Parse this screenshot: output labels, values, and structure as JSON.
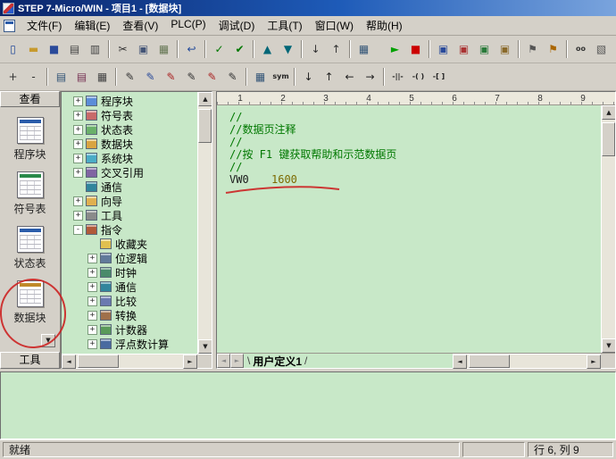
{
  "colors": {
    "editor-bg": "#c8e8c8",
    "comment-color": "#007800",
    "value-color": "#7c6a00",
    "annotation-color": "#cc2222",
    "title-gradient-start": "#0a246a",
    "title-gradient-end": "#7aa4dd"
  },
  "window": {
    "title": "STEP 7-Micro/WIN - 项目1 - [数据块]"
  },
  "menu": {
    "items": [
      {
        "name": "menu-file",
        "label": "文件(F)"
      },
      {
        "name": "menu-edit",
        "label": "编辑(E)"
      },
      {
        "name": "menu-view",
        "label": "查看(V)"
      },
      {
        "name": "menu-plc",
        "label": "PLC(P)"
      },
      {
        "name": "menu-debug",
        "label": "调试(D)"
      },
      {
        "name": "menu-tools",
        "label": "工具(T)"
      },
      {
        "name": "menu-window",
        "label": "窗口(W)"
      },
      {
        "name": "menu-help",
        "label": "帮助(H)"
      }
    ]
  },
  "toolbar_main": {
    "items": [
      {
        "name": "new-button",
        "glyph": "▯",
        "color": "#234a9a"
      },
      {
        "name": "open-button",
        "glyph": "▬",
        "color": "#c79a2e"
      },
      {
        "name": "save-button",
        "glyph": "■",
        "color": "#2a4a9a"
      },
      {
        "name": "print-button",
        "glyph": "▤",
        "color": "#444444"
      },
      {
        "name": "print-preview-button",
        "glyph": "▥",
        "color": "#444444"
      },
      {
        "kind": "sep"
      },
      {
        "name": "cut-button",
        "glyph": "✂",
        "color": "#333333"
      },
      {
        "name": "copy-button",
        "glyph": "▣",
        "color": "#445577"
      },
      {
        "name": "paste-button",
        "glyph": "▦",
        "color": "#667755"
      },
      {
        "kind": "sep"
      },
      {
        "name": "undo-button",
        "glyph": "↩",
        "color": "#234a9a"
      },
      {
        "kind": "sep"
      },
      {
        "name": "compile-button",
        "glyph": "✓",
        "color": "#007700"
      },
      {
        "name": "compile-all-button",
        "glyph": "✔",
        "color": "#007700"
      },
      {
        "kind": "sep"
      },
      {
        "name": "upload-button",
        "glyph": "▲",
        "color": "#006677"
      },
      {
        "name": "download-button",
        "glyph": "▼",
        "color": "#006677"
      },
      {
        "kind": "sep"
      },
      {
        "name": "sort-ascending-button",
        "glyph": "↓",
        "color": "#333333"
      },
      {
        "name": "sort-descending-button",
        "glyph": "↑",
        "color": "#333333"
      },
      {
        "kind": "sep"
      },
      {
        "name": "options-button",
        "glyph": "▦",
        "color": "#335577"
      },
      {
        "kind": "gap"
      },
      {
        "name": "run-button",
        "glyph": "►",
        "color": "#00a000"
      },
      {
        "name": "stop-button",
        "glyph": "■",
        "color": "#cc0000"
      },
      {
        "kind": "sep"
      },
      {
        "name": "program-view-button",
        "glyph": "▣",
        "color": "#2a4a9a"
      },
      {
        "name": "symbol-view-button",
        "glyph": "▣",
        "color": "#aa3333"
      },
      {
        "name": "status-view-button",
        "glyph": "▣",
        "color": "#2a7a3a"
      },
      {
        "name": "data-view-button",
        "glyph": "▣",
        "color": "#8a6a2a"
      },
      {
        "kind": "sep"
      },
      {
        "name": "bookmark-button",
        "glyph": "⚑",
        "color": "#555555"
      },
      {
        "name": "next-bookmark-button",
        "glyph": "⚑",
        "color": "#aa6600"
      },
      {
        "kind": "sep"
      },
      {
        "name": "find-button",
        "glyph": "oo",
        "color": "#333333",
        "small": true
      },
      {
        "name": "browse-button",
        "glyph": "▧",
        "color": "#555555"
      }
    ]
  },
  "toolbar_edit": {
    "items": [
      {
        "name": "expand-all-button",
        "glyph": "+",
        "color": "#333333"
      },
      {
        "name": "collapse-all-button",
        "glyph": "-",
        "color": "#333333"
      },
      {
        "kind": "sep"
      },
      {
        "name": "insert-network-button",
        "glyph": "▤",
        "color": "#335577"
      },
      {
        "name": "delete-network-button",
        "glyph": "▤",
        "color": "#773355"
      },
      {
        "name": "edit-table-button",
        "glyph": "▦",
        "color": "#444444"
      },
      {
        "kind": "sep"
      },
      {
        "name": "toggle-pou-comments-button",
        "glyph": "✎",
        "color": "#333333"
      },
      {
        "name": "toggle-network-comments-button",
        "glyph": "✎",
        "color": "#2a4a9a"
      },
      {
        "name": "toggle-symbol-info-button",
        "glyph": "✎",
        "color": "#aa2222"
      },
      {
        "name": "toggle-bookmark-button",
        "glyph": "✎",
        "color": "#333333"
      },
      {
        "name": "next-bookmark-pen-button",
        "glyph": "✎",
        "color": "#aa2222"
      },
      {
        "name": "clear-bookmarks-button",
        "glyph": "✎",
        "color": "#333333"
      },
      {
        "kind": "sep"
      },
      {
        "name": "symbol-table-toggle-button",
        "glyph": "▦",
        "color": "#335577"
      },
      {
        "name": "sym-toggle-button",
        "glyph": "sym",
        "color": "#222222",
        "small": true
      },
      {
        "kind": "sep"
      },
      {
        "name": "line-down-button",
        "glyph": "↓",
        "color": "#222222"
      },
      {
        "name": "line-up-button",
        "glyph": "↑",
        "color": "#222222"
      },
      {
        "name": "line-left-button",
        "glyph": "←",
        "color": "#222222"
      },
      {
        "name": "line-right-button",
        "glyph": "→",
        "color": "#222222"
      },
      {
        "kind": "sep"
      },
      {
        "name": "insert-contact-button",
        "glyph": "-||-",
        "color": "#222222",
        "small": true
      },
      {
        "name": "insert-coil-button",
        "glyph": "-( )",
        "color": "#222222",
        "small": true
      },
      {
        "name": "insert-box-button",
        "glyph": "-[ ]",
        "color": "#222222",
        "small": true
      }
    ]
  },
  "sidebar": {
    "header": "查看",
    "footer": "工具",
    "scroll_glyph": "▼",
    "items": [
      {
        "name": "sidebar-item-program-block",
        "label": "程序块",
        "accent": "#2a5caa"
      },
      {
        "name": "sidebar-item-symbol-table",
        "label": "符号表",
        "accent": "#2a8a4a"
      },
      {
        "name": "sidebar-item-status-chart",
        "label": "状态表",
        "accent": "#2a5caa"
      },
      {
        "name": "sidebar-item-data-block",
        "label": "数据块",
        "accent": "#c08a2a"
      }
    ]
  },
  "tree": {
    "items": [
      {
        "name": "tree-item-program-block",
        "label": "程序块",
        "expand_glyph": "+",
        "expand_state": "plus",
        "color": "#5b8dd9",
        "level": 1
      },
      {
        "name": "tree-item-symbol-table",
        "label": "符号表",
        "expand_glyph": "+",
        "expand_state": "plus",
        "color": "#c86a6a",
        "level": 1
      },
      {
        "name": "tree-item-status-chart",
        "label": "状态表",
        "expand_glyph": "+",
        "expand_state": "plus",
        "color": "#6ab06a",
        "level": 1
      },
      {
        "name": "tree-item-data-block",
        "label": "数据块",
        "expand_glyph": "+",
        "expand_state": "plus",
        "color": "#d9a441",
        "level": 1
      },
      {
        "name": "tree-item-system-block",
        "label": "系统块",
        "expand_glyph": "+",
        "expand_state": "plus",
        "color": "#4bacc6",
        "level": 1
      },
      {
        "name": "tree-item-cross-reference",
        "label": "交叉引用",
        "expand_glyph": "+",
        "expand_state": "plus",
        "color": "#8064a2",
        "level": 1
      },
      {
        "name": "tree-item-communication",
        "label": "通信",
        "expand_glyph": "",
        "expand_state": "none",
        "color": "#31859c",
        "level": 1
      },
      {
        "name": "tree-item-wizard",
        "label": "向导",
        "expand_glyph": "+",
        "expand_state": "plus",
        "color": "#e0b050",
        "level": 1
      },
      {
        "name": "tree-item-tools",
        "label": "工具",
        "expand_glyph": "+",
        "expand_state": "plus",
        "color": "#8a8a8a",
        "level": 1
      },
      {
        "name": "tree-item-instructions",
        "label": "指令",
        "expand_glyph": "-",
        "expand_state": "minus",
        "color": "#b05a3a",
        "level": 1
      },
      {
        "name": "tree-item-favorites",
        "label": "收藏夹",
        "expand_glyph": "",
        "expand_state": "none",
        "color": "#e0c050",
        "level": 2
      },
      {
        "name": "tree-item-bit-logic",
        "label": "位逻辑",
        "expand_glyph": "+",
        "expand_state": "plus",
        "color": "#607a9a",
        "level": 2
      },
      {
        "name": "tree-item-clock",
        "label": "时钟",
        "expand_glyph": "+",
        "expand_state": "plus",
        "color": "#4a8a6a",
        "level": 2
      },
      {
        "name": "tree-item-communication-2",
        "label": "通信",
        "expand_glyph": "+",
        "expand_state": "plus",
        "color": "#31859c",
        "level": 2
      },
      {
        "name": "tree-item-compare",
        "label": "比较",
        "expand_glyph": "+",
        "expand_state": "plus",
        "color": "#6a7ab0",
        "level": 2
      },
      {
        "name": "tree-item-convert",
        "label": "转换",
        "expand_glyph": "+",
        "expand_state": "plus",
        "color": "#a0704a",
        "level": 2
      },
      {
        "name": "tree-item-counters",
        "label": "计数器",
        "expand_glyph": "+",
        "expand_state": "plus",
        "color": "#5a9a5a",
        "level": 2
      },
      {
        "name": "tree-item-floating-point-math",
        "label": "浮点数计算",
        "expand_glyph": "+",
        "expand_state": "plus",
        "color": "#4a6aa0",
        "level": 2
      }
    ]
  },
  "editor": {
    "ruler": [
      {
        "label": "1"
      },
      {
        "label": "2"
      },
      {
        "label": "3"
      },
      {
        "label": "4"
      },
      {
        "label": "5"
      },
      {
        "label": "6"
      },
      {
        "label": "7"
      },
      {
        "label": "8"
      },
      {
        "label": "9"
      }
    ],
    "lines": [
      {
        "kind": "comment",
        "text": "//"
      },
      {
        "kind": "comment",
        "text": "//数据页注释"
      },
      {
        "kind": "comment",
        "text": "//"
      },
      {
        "kind": "comment",
        "text": "//按 F1 键获取帮助和示范数据页"
      },
      {
        "kind": "comment",
        "text": "//"
      },
      {
        "kind": "code",
        "addr": "VW0",
        "value": "1600"
      }
    ],
    "tab": {
      "label": "用户定义1"
    }
  },
  "scrollbar": {
    "up": "▲",
    "down": "▼",
    "left": "◄",
    "right": "►"
  },
  "statusbar": {
    "ready": "就绪",
    "position": "行 6, 列 9"
  }
}
